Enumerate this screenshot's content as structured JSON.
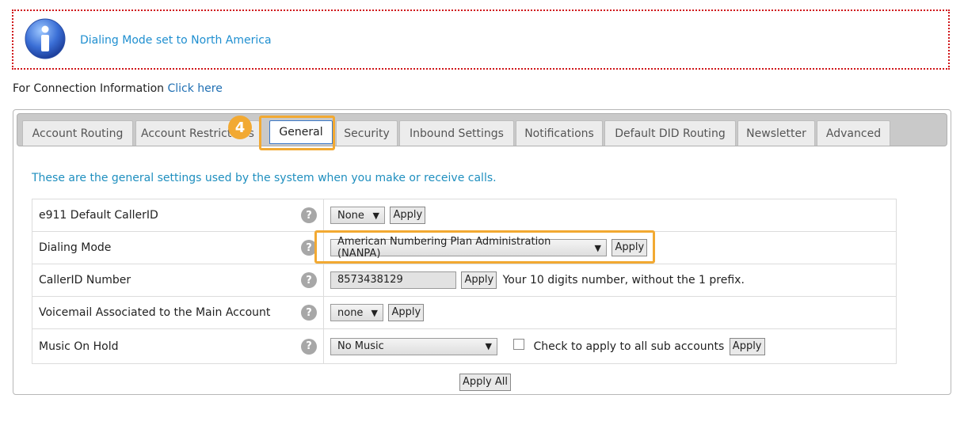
{
  "notice": {
    "icon": "info-icon",
    "message": "Dialing Mode set to North America"
  },
  "connection": {
    "prefix": "For Connection Information",
    "link": "Click here"
  },
  "tabs": [
    {
      "label": "Account Routing"
    },
    {
      "label": "Account Restrictions"
    },
    {
      "label": "General",
      "active": true
    },
    {
      "label": "Security"
    },
    {
      "label": "Inbound Settings"
    },
    {
      "label": "Notifications"
    },
    {
      "label": "Default DID Routing"
    },
    {
      "label": "Newsletter"
    },
    {
      "label": "Advanced"
    }
  ],
  "step_badge": "4",
  "intro": "These are the general settings used by the system when you make or receive calls.",
  "rows": {
    "e911": {
      "label": "e911 Default CallerID",
      "select": "None",
      "apply": "Apply"
    },
    "dialing": {
      "label": "Dialing Mode",
      "select": "American Numbering Plan Administration (NANPA)",
      "apply": "Apply"
    },
    "callerid": {
      "label": "CallerID Number",
      "value": "8573438129",
      "apply": "Apply",
      "hint": "Your 10 digits number, without the 1 prefix."
    },
    "voicemail": {
      "label": "Voicemail Associated to the Main Account",
      "select": "none",
      "apply": "Apply"
    },
    "moh": {
      "label": "Music On Hold",
      "select": "No Music",
      "checkbox_label": "Check to apply to all sub accounts",
      "apply": "Apply"
    }
  },
  "apply_all": "Apply All",
  "colors": {
    "highlight": "#f2a932",
    "notice_border": "#d0161a",
    "link": "#1f8fd0"
  }
}
